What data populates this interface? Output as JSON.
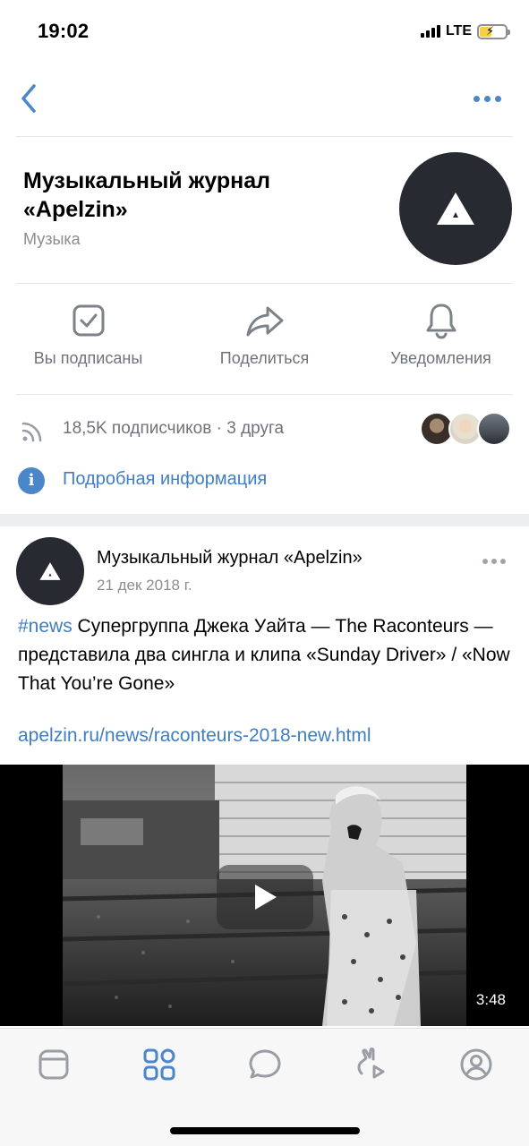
{
  "status_bar": {
    "time": "19:02",
    "network": "LTE"
  },
  "nav": {
    "back_icon": "chevron-left-icon",
    "more_icon": "more-horizontal-icon"
  },
  "group": {
    "title": "Музыкальный журнал «Apelzin»",
    "category": "Музыка"
  },
  "actions": [
    {
      "label": "Вы подписаны",
      "icon": "subscribed-check-icon"
    },
    {
      "label": "Поделиться",
      "icon": "share-arrow-icon"
    },
    {
      "label": "Уведомления",
      "icon": "bell-icon"
    }
  ],
  "stats": {
    "text": "18,5K подписчиков · 3 друга"
  },
  "info": {
    "label": "Подробная информация",
    "icon": "info-icon"
  },
  "post": {
    "author": "Музыкальный журнал «Apelzin»",
    "date": "21 дек 2018 г.",
    "hashtag": "#news",
    "text": " Супергруппа Джека Уайта — The Raconteurs — представила два сингла и клипа «Sunday Driver» / «Now That You’re Gone»",
    "link": "apelzin.ru/news/raconteurs-2018-new.html",
    "video_duration": "3:48"
  },
  "tab_bar": [
    {
      "name": "tab-news",
      "icon": "news-feed-icon"
    },
    {
      "name": "tab-services",
      "icon": "services-grid-icon",
      "active": true
    },
    {
      "name": "tab-messages",
      "icon": "message-bubble-icon"
    },
    {
      "name": "tab-clips",
      "icon": "clips-icon"
    },
    {
      "name": "tab-profile",
      "icon": "profile-icon"
    }
  ],
  "colors": {
    "accent": "#4a86c8",
    "link": "#3f7ec3",
    "secondary_text": "#6e7379",
    "avatar_bg": "#272a31"
  }
}
